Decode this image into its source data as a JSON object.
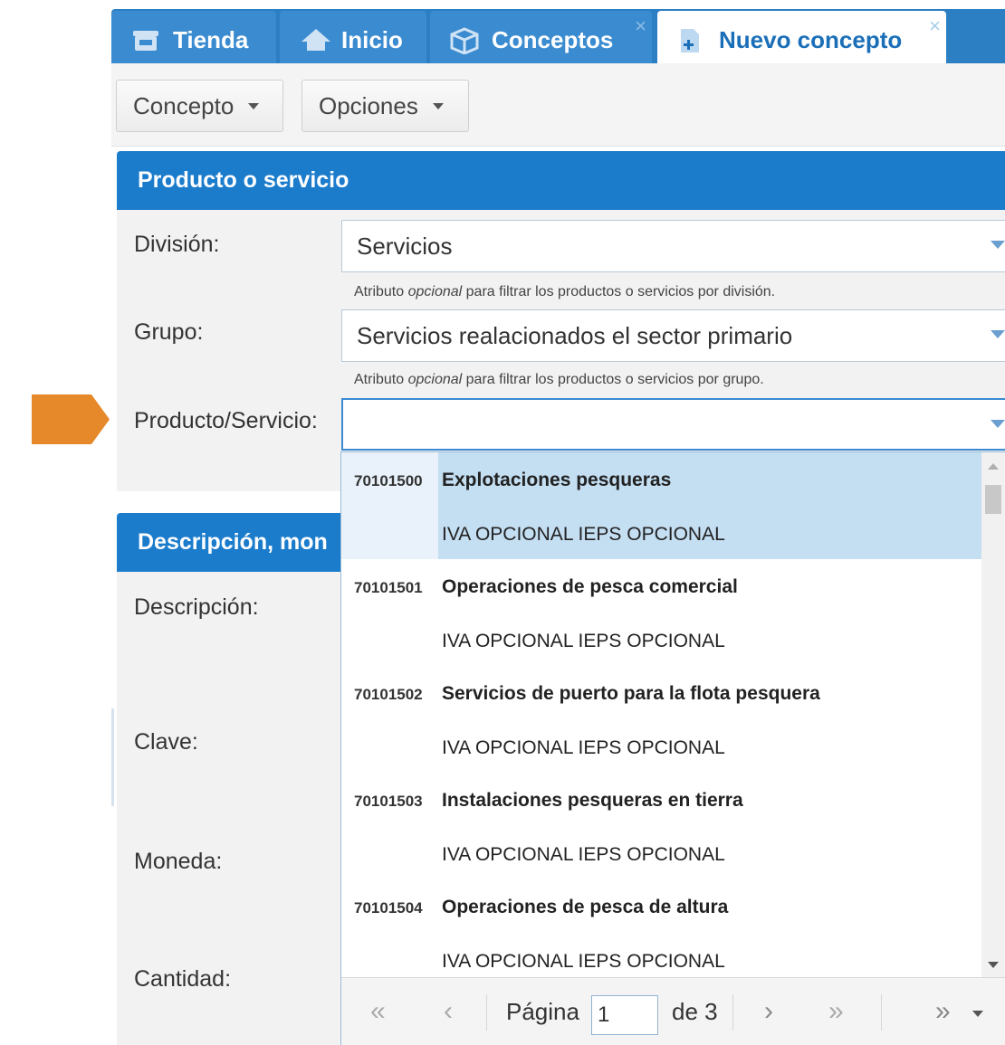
{
  "colors": {
    "accent": "#1b7ccc",
    "tab_bg": "#3a8bd0",
    "selected_row": "#c4def2",
    "arrow": "#e6892a"
  },
  "tabs": [
    {
      "label": "Tienda",
      "icon": "store-icon"
    },
    {
      "label": "Inicio",
      "icon": "home-icon"
    },
    {
      "label": "Conceptos",
      "icon": "box-icon",
      "close": "×"
    },
    {
      "label": "Nuevo concepto",
      "icon": "new-document-icon",
      "close": "×",
      "active": true
    }
  ],
  "toolbar": {
    "concepto_label": "Concepto",
    "opciones_label": "Opciones"
  },
  "panel_producto": {
    "title": "Producto o servicio",
    "division_label": "División:",
    "division_value": "Servicios",
    "division_hint_pre": "Atributo ",
    "division_hint_em": "opcional",
    "division_hint_post": " para filtrar los productos o servicios por división.",
    "grupo_label": "Grupo:",
    "grupo_value": "Servicios realacionados el sector primario",
    "grupo_hint_pre": "Atributo ",
    "grupo_hint_em": "opcional",
    "grupo_hint_post": " para filtrar los productos o servicios por grupo.",
    "producto_label": "Producto/Servicio:",
    "producto_value": ""
  },
  "panel_descripcion": {
    "title": "Descripción, mon",
    "descripcion_label": "Descripción:",
    "clave_label": "Clave:",
    "moneda_label": "Moneda:",
    "cantidad_label": "Cantidad:"
  },
  "dropdown": {
    "items": [
      {
        "code": "70101500",
        "name": "Explotaciones pesqueras",
        "tax": "IVA OPCIONAL IEPS OPCIONAL",
        "selected": true
      },
      {
        "code": "70101501",
        "name": "Operaciones de pesca comercial",
        "tax": "IVA OPCIONAL IEPS OPCIONAL"
      },
      {
        "code": "70101502",
        "name": "Servicios de puerto para la flota pesquera",
        "tax": "IVA OPCIONAL IEPS OPCIONAL"
      },
      {
        "code": "70101503",
        "name": "Instalaciones pesqueras en tierra",
        "tax": "IVA OPCIONAL IEPS OPCIONAL"
      },
      {
        "code": "70101504",
        "name": "Operaciones de pesca de altura",
        "tax": "IVA OPCIONAL IEPS OPCIONAL"
      }
    ],
    "pager": {
      "first": "«",
      "prev": "‹",
      "page_label": "Página",
      "page_value": "1",
      "of_label": "de 3",
      "next": "›",
      "last": "»",
      "more": "»"
    }
  }
}
